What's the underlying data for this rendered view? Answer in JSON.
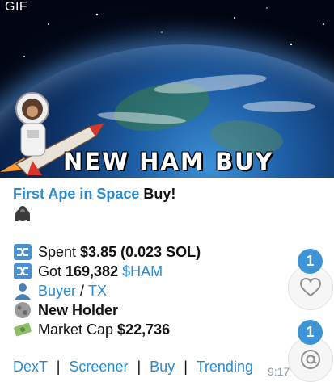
{
  "media": {
    "badge": "GIF",
    "banner_text": "NEW HAM BUY"
  },
  "message": {
    "title_link": "First Ape in Space",
    "title_suffix": " Buy!",
    "spent_label": "Spent ",
    "spent_value": "$3.85 (0.023 SOL)",
    "got_label": "Got ",
    "got_amount": "169,382",
    "got_token": "$HAM",
    "buyer_link": "Buyer",
    "buyer_sep": " / ",
    "tx_link": "TX",
    "holder_status": "New Holder",
    "mcap_label": "Market Cap ",
    "mcap_value": "$22,736"
  },
  "footer": {
    "links": [
      "DexT",
      "Screener",
      "Buy",
      "Trending"
    ],
    "separator": "|",
    "time": "9:17"
  },
  "reactions": [
    {
      "icon": "heart-icon",
      "count": "1"
    },
    {
      "icon": "mention-icon",
      "count": "1"
    }
  ],
  "colors": {
    "link": "#2a8ad1",
    "badge": "#3b95d6"
  }
}
